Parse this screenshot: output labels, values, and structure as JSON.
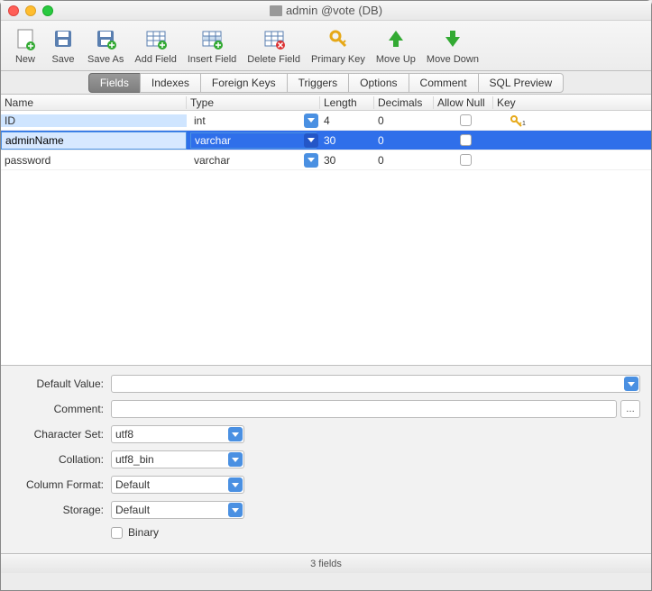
{
  "title": "admin @vote (DB)",
  "toolbar": [
    {
      "name": "new",
      "label": "New"
    },
    {
      "name": "save",
      "label": "Save"
    },
    {
      "name": "saveas",
      "label": "Save As"
    },
    {
      "name": "addfield",
      "label": "Add Field"
    },
    {
      "name": "insertfield",
      "label": "Insert Field"
    },
    {
      "name": "deletefield",
      "label": "Delete Field"
    },
    {
      "name": "primarykey",
      "label": "Primary Key"
    },
    {
      "name": "moveup",
      "label": "Move Up"
    },
    {
      "name": "movedown",
      "label": "Move Down"
    }
  ],
  "tabs": [
    "Fields",
    "Indexes",
    "Foreign Keys",
    "Triggers",
    "Options",
    "Comment",
    "SQL Preview"
  ],
  "active_tab": "Fields",
  "columns": {
    "name": "Name",
    "type": "Type",
    "length": "Length",
    "decimals": "Decimals",
    "allow_null": "Allow Null",
    "key": "Key"
  },
  "rows": [
    {
      "name": "ID",
      "type": "int",
      "length": "4",
      "decimals": "0",
      "allow_null": false,
      "key": true,
      "selected": false,
      "first_col_sel": true
    },
    {
      "name": "adminName",
      "type": "varchar",
      "length": "30",
      "decimals": "0",
      "allow_null": false,
      "key": false,
      "selected": true,
      "first_col_sel": false
    },
    {
      "name": "password",
      "type": "varchar",
      "length": "30",
      "decimals": "0",
      "allow_null": false,
      "key": false,
      "selected": false,
      "first_col_sel": false
    }
  ],
  "details": {
    "default_label": "Default Value:",
    "comment_label": "Comment:",
    "charset_label": "Character Set:",
    "collation_label": "Collation:",
    "colfmt_label": "Column Format:",
    "storage_label": "Storage:",
    "binary_label": "Binary",
    "default_value": "",
    "comment": "",
    "charset": "utf8",
    "collation": "utf8_bin",
    "colfmt": "Default",
    "storage": "Default",
    "binary": false
  },
  "status": "3 fields"
}
